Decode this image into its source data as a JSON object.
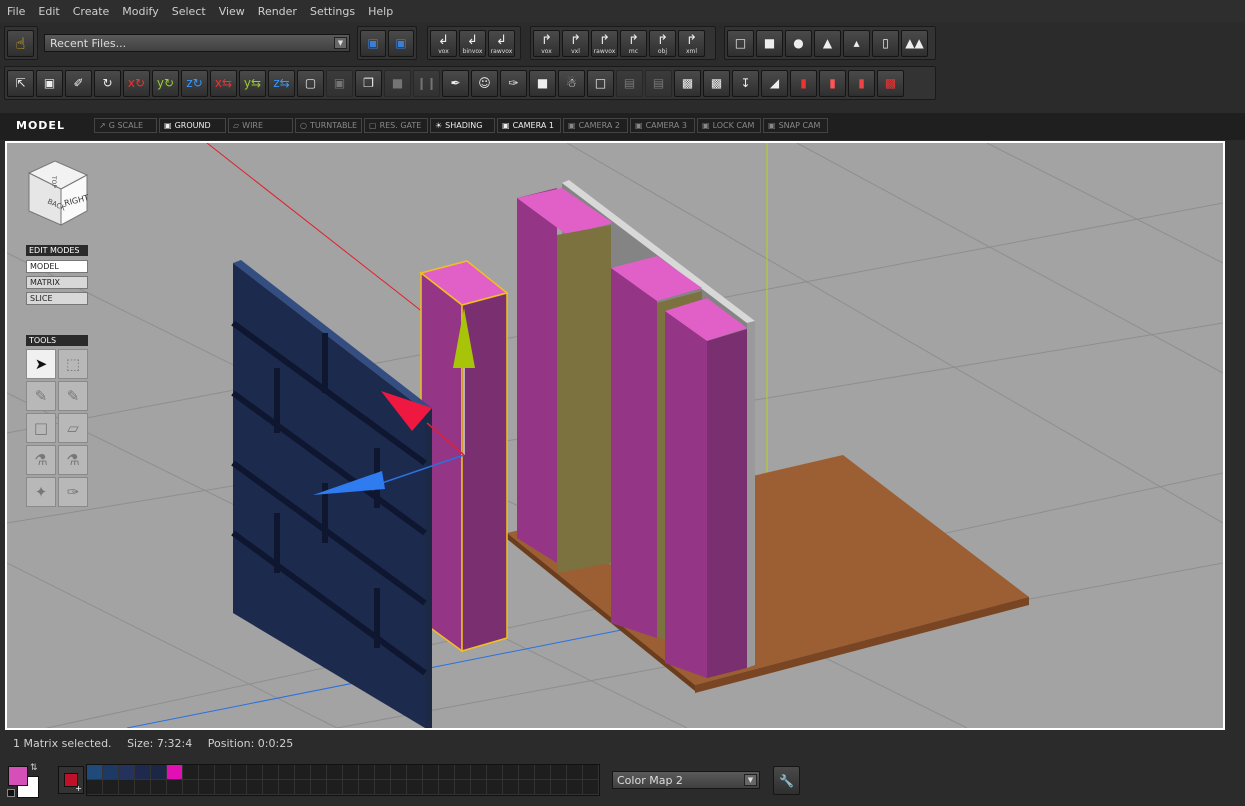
{
  "menu": [
    "File",
    "Edit",
    "Create",
    "Modify",
    "Select",
    "View",
    "Render",
    "Settings",
    "Help"
  ],
  "toolbar1": {
    "recent_files": "Recent Files...",
    "import_labels": [
      "vox",
      "binvox",
      "rawvox"
    ],
    "export_labels": [
      "vox",
      "vxl",
      "rawvox",
      "mc",
      "obj",
      "xml"
    ]
  },
  "viewbar": {
    "mode": "MODEL",
    "buttons": [
      {
        "label": "G SCALE",
        "on": false
      },
      {
        "label": "GROUND",
        "on": true
      },
      {
        "label": "WIRE",
        "on": false
      },
      {
        "label": "TURNTABLE",
        "on": false
      },
      {
        "label": "RES. GATE",
        "on": false
      },
      {
        "label": "SHADING",
        "on": true
      },
      {
        "label": "CAMERA 1",
        "on": true
      },
      {
        "label": "CAMERA 2",
        "on": false
      },
      {
        "label": "CAMERA 3",
        "on": false
      },
      {
        "label": "LOCK CAM",
        "on": false
      },
      {
        "label": "SNAP CAM",
        "on": false
      }
    ]
  },
  "viewcube": {
    "front": "RIGHT",
    "side": "BACK",
    "top": "TOP"
  },
  "edit_modes": {
    "title": "EDIT MODES",
    "items": [
      "MODEL",
      "MATRIX",
      "SLICE"
    ],
    "active": "MODEL"
  },
  "tools": {
    "title": "TOOLS"
  },
  "status": {
    "selection": "1 Matrix selected.",
    "size": "Size: 7:32:4",
    "position": "Position: 0:0:25"
  },
  "colors": {
    "primary": "#d54fb8",
    "secondary": "#ffffff",
    "active_swatch": "#c0102a",
    "palette": [
      "#1f4a7a",
      "#1c3a63",
      "#23335d",
      "#1d2a4d",
      "#1c2645",
      "#e010b5"
    ]
  },
  "colormap": {
    "selected": "Color Map 2"
  }
}
